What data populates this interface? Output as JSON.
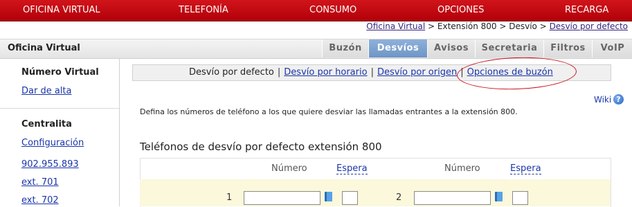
{
  "topnav": [
    "OFICINA VIRTUAL",
    "TELEFONÍA",
    "CONSUMO",
    "OPCIONES",
    "RECARGA"
  ],
  "breadcrumb": {
    "link1": "Oficina Virtual",
    "sep1": " > ",
    "middle": "Extensión 800 > Desvío > ",
    "link2": "Desvío por defecto"
  },
  "header": {
    "title": "Oficina Virtual"
  },
  "tabs": [
    "Buzón",
    "Desvíos",
    "Avisos",
    "Secretaria",
    "Filtros",
    "VoIP"
  ],
  "active_tab": "Desvíos",
  "sidebar": {
    "h1": "Número Virtual",
    "link_alta": "Dar de alta",
    "h2": "Centralita",
    "links": [
      "Configuración",
      "902.955.893",
      "ext. 701",
      "ext. 702"
    ]
  },
  "subnav": {
    "current": "Desvío por defecto",
    "links": [
      "Desvío por horario",
      "Desvío por origen",
      "Opciones de buzón"
    ],
    "separator": "|"
  },
  "wiki": {
    "label": "Wiki",
    "icon": "help-icon"
  },
  "description": "Defina los números de teléfono a los que quiere desviar las llamadas entrantes a la extensión 800.",
  "section_title": "Teléfonos de desvío por defecto extensión 800",
  "table": {
    "col_numero": "Número",
    "col_espera": "Espera",
    "rows": [
      {
        "index": "1",
        "numero": "",
        "espera": ""
      },
      {
        "index": "2",
        "numero": "",
        "espera": ""
      }
    ]
  },
  "colors": {
    "topnav": "#c40c14",
    "tab_active": "#7ea3d0",
    "row_bg": "#fbf8dc",
    "link": "#1a35a8",
    "highlight_circle": "#c8101a"
  }
}
